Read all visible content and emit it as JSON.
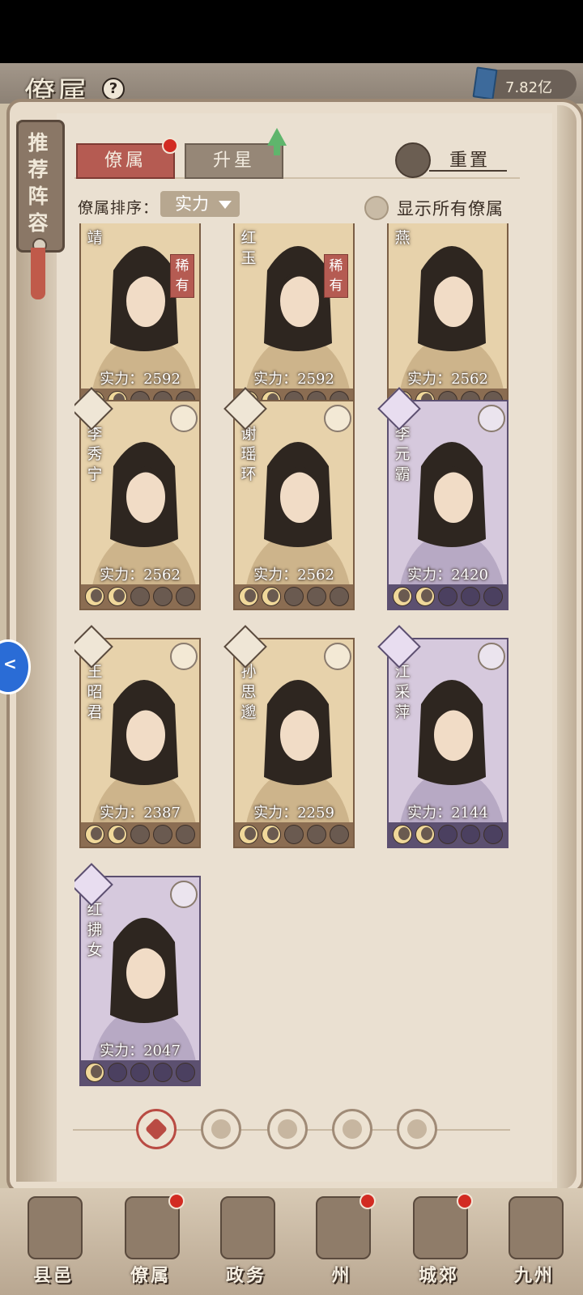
{
  "header": {
    "title": "僚属",
    "currency_value": "7.82亿"
  },
  "side_tab": {
    "label": "推荐阵容"
  },
  "tabs": [
    {
      "label": "僚属",
      "active": true,
      "badge": true
    },
    {
      "label": "升星",
      "active": false,
      "badge": false
    }
  ],
  "reset_label": "重置",
  "sort": {
    "label": "僚属排序：",
    "value": "实力"
  },
  "show_all_label": "显示所有僚属",
  "cards": [
    {
      "name": "靖",
      "power": "实力：2592",
      "rare": "稀有",
      "stars": 2,
      "frame": "gold",
      "icon": ""
    },
    {
      "name": "红玉",
      "power": "实力：2592",
      "rare": "稀有",
      "stars": 2,
      "frame": "gold",
      "icon": ""
    },
    {
      "name": "燕",
      "power": "实力：2562",
      "rare": "",
      "stars": 2,
      "frame": "gold",
      "icon": ""
    },
    {
      "name": "李秀宁",
      "power": "实力：2562",
      "rare": "",
      "stars": 2,
      "frame": "gold",
      "icon": "sword-icon"
    },
    {
      "name": "谢瑶环",
      "power": "实力：2562",
      "rare": "",
      "stars": 2,
      "frame": "gold",
      "icon": "sword-icon"
    },
    {
      "name": "李元霸",
      "power": "实力：2420",
      "rare": "",
      "stars": 2,
      "frame": "purple",
      "icon": "book-icon"
    },
    {
      "name": "王昭君",
      "power": "实力：2387",
      "rare": "",
      "stars": 2,
      "frame": "gold",
      "icon": "yinyang-icon"
    },
    {
      "name": "孙思邈",
      "power": "实力：2259",
      "rare": "",
      "stars": 2,
      "frame": "gold",
      "icon": "lotus-icon"
    },
    {
      "name": "江采萍",
      "power": "实力：2144",
      "rare": "",
      "stars": 2,
      "frame": "purple",
      "icon": "lotus-icon"
    },
    {
      "name": "红拂女",
      "power": "实力：2047",
      "rare": "",
      "stars": 1,
      "frame": "purple",
      "icon": "yinyang-icon"
    }
  ],
  "filters": [
    "all-filter-icon",
    "bell-icon",
    "cat-icon",
    "fan-icon",
    "dog-icon"
  ],
  "bottom_nav": [
    {
      "label": "县邑",
      "badge": false
    },
    {
      "label": "僚属",
      "badge": true
    },
    {
      "label": "政务",
      "badge": false
    },
    {
      "label": "州",
      "badge": true
    },
    {
      "label": "城郊",
      "badge": true
    },
    {
      "label": "九州",
      "badge": false
    }
  ],
  "colors": {
    "accent_red": "#b55b52",
    "gold_frame": "#e7d2ab",
    "purple_frame": "#d6c9dd",
    "page": "#eae0d1"
  }
}
